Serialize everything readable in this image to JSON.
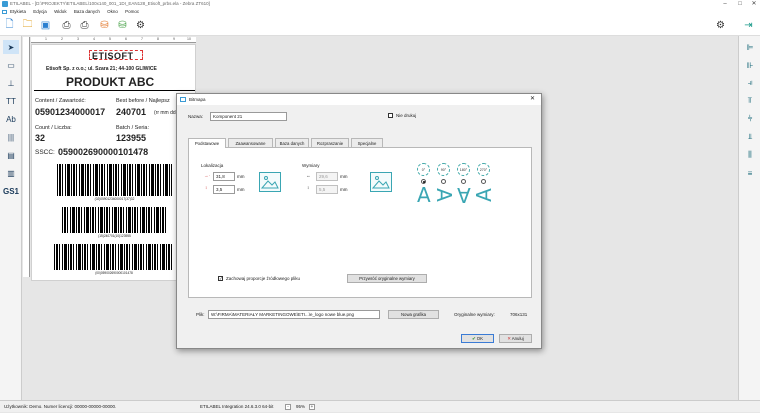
{
  "window": {
    "title": "ETILABEL - [D:\\PROJEKTY\\ETILABEL\\100x140_001_1DI_EAN128_Etisoft_prbs.ela - Zebra ZT610]"
  },
  "menu": [
    "Etykieta",
    "Edycja",
    "Widok",
    "Baza danych",
    "Okno",
    "Pomoc"
  ],
  "toolbar_icons": [
    "new-icon",
    "open-icon",
    "save-icon",
    "print-icon",
    "print-preview-icon",
    "database-icon",
    "plugin-icon",
    "settings-icon"
  ],
  "label": {
    "logo": "ETISOFT",
    "company": "Etisoft Sp. z o.o.; ul. Szara 21; 44-100 GLIWICE",
    "product": "PRODUKT ABC",
    "content_label": "Content / Zawartość:",
    "content_value": "05901234000017",
    "best_label": "Best before / Najlepsz",
    "best_value": "240701",
    "best_hint": "(rr mm dd",
    "count_label": "Count / Liczba:",
    "count_value": "32",
    "batch_label": "Batch / Seria:",
    "batch_value": "123955",
    "sscc_label": "SSCC:",
    "sscc_value": "059002690000101478",
    "bc1_text": "(02)05901234000017(37)32",
    "bc2_text": "(15)240701(10)123955",
    "bc3_text": "(00)059002690000101478"
  },
  "ruler": [
    "1",
    "2",
    "3",
    "4",
    "5",
    "6",
    "7",
    "8",
    "9",
    "10"
  ],
  "dialog": {
    "title": "Bitmapa",
    "name_label": "Nazwa:",
    "name_value": "Komponent 21",
    "noprint_label": "Nie drukuj",
    "tabs": [
      "Podstawowe",
      "Zaawansowane",
      "Baza danych",
      "Rozpraszanie",
      "Specjalne"
    ],
    "location_label": "Lokalizacja",
    "x_value": "31,8",
    "y_value": "3,5",
    "unit": "mm",
    "size_label": "Wymiary",
    "w_value": "29,6",
    "h_value": "5,5",
    "rotations": [
      "0°",
      "90°",
      "180°",
      "270°"
    ],
    "letter": "A",
    "keep_ratio_label": "Zachowaj proporcje źródłowego pliku",
    "restore_label": "Przywróć oryginalne wymiary",
    "file_label": "Plik:",
    "file_value": "W:\\FIRMA\\MATERIAŁY MARKETINGOWE\\ETI...\\e_logo nowe blue.png",
    "new_graphic": "Nowa grafika",
    "orig_dims_label": "Oryginalne wymiary:",
    "orig_dims_value": "706x131",
    "ok": "OK",
    "cancel": "Anuluj"
  },
  "status": {
    "user": "Użytkownik: Demo. Numer licencji: 00000-00000-00000.",
    "version": "ETILABEL Integration 24.6.3.0 64-bit",
    "zoom": "95%"
  }
}
